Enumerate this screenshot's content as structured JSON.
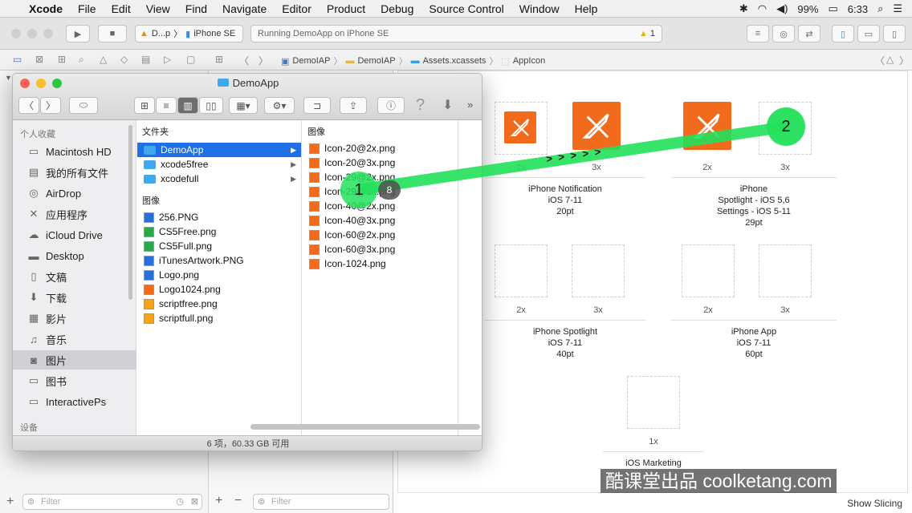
{
  "menubar": {
    "app_name": "Xcode",
    "items": [
      "File",
      "Edit",
      "View",
      "Find",
      "Navigate",
      "Editor",
      "Product",
      "Debug",
      "Source Control",
      "Window",
      "Help"
    ],
    "battery": "99%",
    "time": "6:33"
  },
  "toolbar": {
    "scheme_app": "D...p",
    "scheme_device": "iPhone SE",
    "status_text": "Running DemoApp on iPhone SE",
    "warning_count": "1"
  },
  "breadcrumb": [
    "DemoIAP",
    "DemoIAP",
    "Assets.xcassets",
    "AppIcon"
  ],
  "finder": {
    "title": "DemoApp",
    "sidebar_header_favorites": "个人收藏",
    "sidebar_header_devices": "设备",
    "sidebar_items": [
      "Macintosh HD",
      "我的所有文件",
      "AirDrop",
      "应用程序",
      "iCloud Drive",
      "Desktop",
      "文稿",
      "下载",
      "影片",
      "音乐",
      "图片",
      "图书",
      "InteractivePs"
    ],
    "col1_header_folders": "文件夹",
    "col1_folders": [
      "DemoApp",
      "xcode5free",
      "xcodefull"
    ],
    "col1_header_images": "图像",
    "col1_images": [
      "256.PNG",
      "CS5Free.png",
      "CS5Full.png",
      "iTunesArtwork.PNG",
      "Logo.png",
      "Logo1024.png",
      "scriptfree.png",
      "scriptfull.png"
    ],
    "col2_header": "图像",
    "col2_images": [
      "Icon-20@2x.png",
      "Icon-20@3x.png",
      "Icon-29@2x.png",
      "Icon-29@3x.png",
      "Icon-40@2x.png",
      "Icon-40@3x.png",
      "Icon-60@2x.png",
      "Icon-60@3x.png",
      "Icon-1024.png"
    ],
    "status": "6 项，60.33 GB 可用"
  },
  "appicon": {
    "groups": [
      {
        "name": "iPhone Notification",
        "line2": "iOS 7-11",
        "line3": "20pt",
        "line4": ""
      },
      {
        "name": "iPhone",
        "line2": "Spotlight - iOS 5,6",
        "line3": "Settings - iOS 5-11",
        "line4": "29pt"
      },
      {
        "name": "iPhone Spotlight",
        "line2": "iOS 7-11",
        "line3": "40pt",
        "line4": ""
      },
      {
        "name": "iPhone App",
        "line2": "iOS 7-11",
        "line3": "60pt",
        "line4": ""
      },
      {
        "name": "iOS Marketing",
        "line2": "",
        "line3": "",
        "line4": ""
      }
    ],
    "scale_2x": "2x",
    "scale_3x": "3x",
    "scale_1x": "1x"
  },
  "overlay": {
    "bubble1": "1",
    "bubble1_count": "8",
    "bubble2": "2",
    "arrows": "> > > > >",
    "accent": "#22e05a"
  },
  "bottom": {
    "filter_placeholder": "Filter",
    "show_slicing": "Show Slicing",
    "watermark": "酷课堂出品 coolketang.com"
  }
}
